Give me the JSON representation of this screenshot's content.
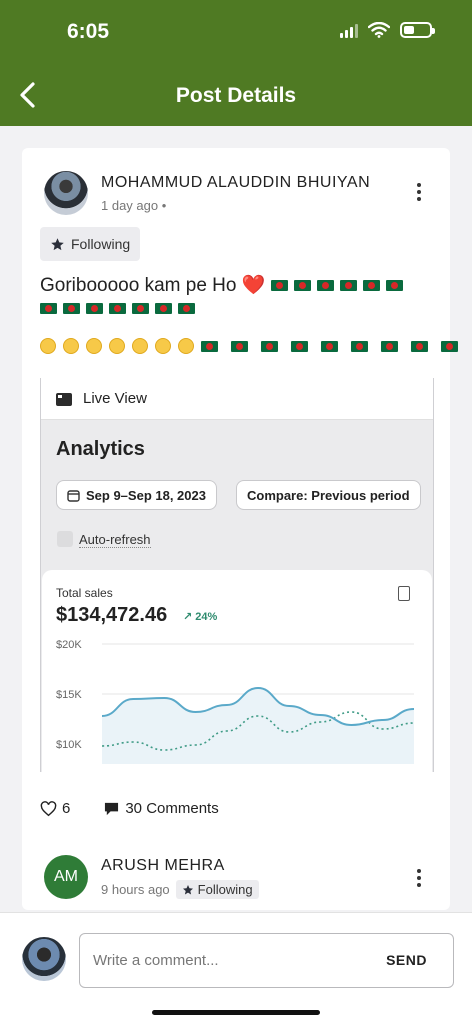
{
  "status_bar": {
    "time": "6:05"
  },
  "header": {
    "title": "Post Details"
  },
  "post": {
    "author": "MOHAMMUD ALAUDDIN  BHUIYAN",
    "meta": "1 day ago •",
    "follow_label": "Following",
    "text": "Goribooooo kam pe Ho ❤️"
  },
  "embed": {
    "live_view_label": "Live View",
    "title": "Analytics",
    "date_range": "Sep 9–Sep 18, 2023",
    "compare_label": "Compare: Previous period",
    "auto_refresh_label": "Auto-refresh",
    "sales_label": "Total sales",
    "sales_value": "$134,472.46",
    "sales_change": "24%"
  },
  "chart_data": {
    "type": "line",
    "y_tick_labels": [
      "$20K",
      "$15K",
      "$10K"
    ],
    "ylim": [
      8000,
      20000
    ],
    "series": [
      {
        "values": [
          12800,
          14500,
          14600,
          13200,
          13900,
          15600,
          13800,
          12900,
          11900,
          12400,
          13500
        ]
      },
      {
        "values": [
          9800,
          10200,
          9400,
          9900,
          11300,
          12800,
          11200,
          12200,
          13200,
          11500,
          12100
        ]
      }
    ],
    "colors": {
      "current": "#5aa9c9",
      "previous": "#3f9b86"
    },
    "grid": true
  },
  "stats": {
    "likes": "6",
    "comments": "30 Comments"
  },
  "comment": {
    "initials": "AM",
    "author": "ARUSH MEHRA",
    "time": "9 hours ago",
    "follow_label": "Following"
  },
  "composer": {
    "placeholder": "Write a comment...",
    "send_label": "SEND"
  },
  "icons": {
    "back": "chevron-left-icon",
    "more": "more-vertical-icon",
    "star": "star-icon",
    "like": "heart-icon",
    "comment": "comment-bubble-icon"
  }
}
